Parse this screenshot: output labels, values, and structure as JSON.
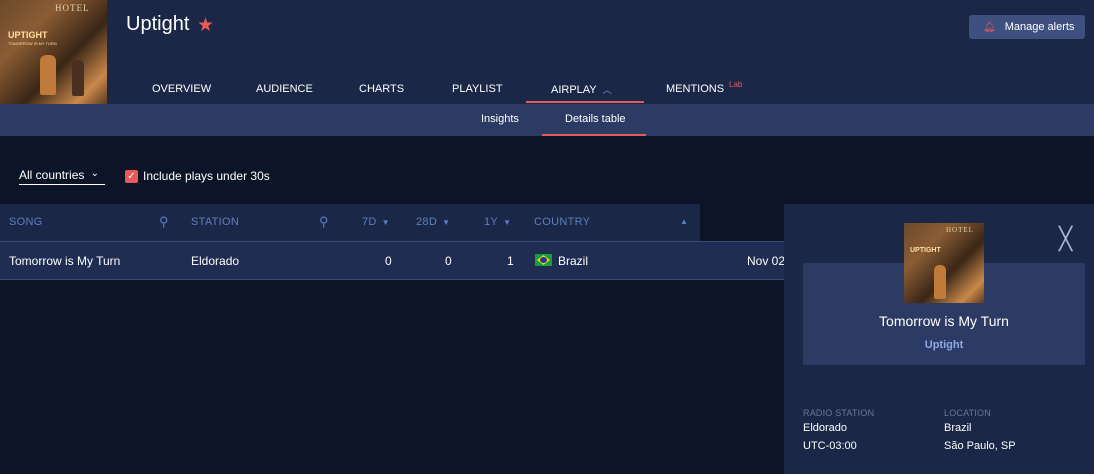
{
  "header": {
    "artist": "Uptight",
    "manage_alerts": "Manage alerts",
    "cover": {
      "hotel": "HOTEL",
      "title": "UPTIGHT",
      "subtitle": "TOMORROW IS MY TURN"
    },
    "tabs": [
      "OVERVIEW",
      "AUDIENCE",
      "CHARTS",
      "PLAYLIST",
      "AIRPLAY",
      "MENTIONS"
    ],
    "mentions_badge": "Lab",
    "active_tab": "AIRPLAY"
  },
  "subnav": {
    "items": [
      "Insights",
      "Details table"
    ],
    "active": "Details table"
  },
  "filters": {
    "country": "All countries",
    "include_short_plays": "Include plays under 30s",
    "include_short_plays_checked": true
  },
  "table": {
    "columns": [
      "SONG",
      "STATION",
      "7D",
      "28D",
      "1Y",
      "COUNTRY"
    ],
    "rows": [
      {
        "song": "Tomorrow is My Turn",
        "station": "Eldorado",
        "d7": "0",
        "d28": "0",
        "y1": "1",
        "country": "Brazil",
        "date": "Nov 02"
      }
    ]
  },
  "panel": {
    "song": "Tomorrow is My Turn",
    "artist": "Uptight",
    "radio_station_label": "RADIO STATION",
    "radio_station": "Eldorado",
    "timezone": "UTC-03:00",
    "location_label": "LOCATION",
    "location_country": "Brazil",
    "location_city": "São Paulo, SP"
  },
  "colors": {
    "accent": "#e85a5a",
    "header_bg": "#1b2746",
    "subnav_bg": "#2c3b63",
    "page_bg": "#0c1427",
    "column_header": "#5f7ec2"
  }
}
